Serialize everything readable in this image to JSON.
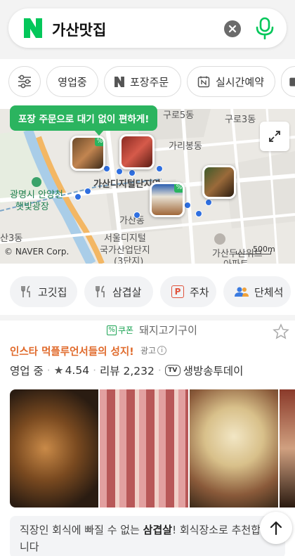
{
  "search": {
    "query": "가산맛집",
    "logo_icon": "naver-n-logo",
    "brand_color": "#03c75a"
  },
  "filters": [
    {
      "label": "",
      "icon": "sliders-icon"
    },
    {
      "label": "영업중"
    },
    {
      "label": "포장주문",
      "icon": "naver-n-icon"
    },
    {
      "label": "실시간예약",
      "icon": "calendar-n-icon"
    }
  ],
  "map": {
    "tooltip": "포장 주문으로 대기 없이 편하게!",
    "labels": {
      "guro3": "구로3동",
      "guro5": "구로5동",
      "garibong": "가리봉동",
      "gasan_digital_station": "가산디지털단지역",
      "gwangmyeong": "광명시 안양천",
      "haetbit": "햇빛광장",
      "gasandong": "가산동",
      "san3": "산3동",
      "seoul_digital_1": "서울디지털",
      "seoul_digital_2": "국가산업단지",
      "seoul_digital_3": "(3단지)",
      "apt_1": "가산두산위브",
      "apt_2": "아파트"
    },
    "credit": "© NAVER Corp.",
    "scale": "500m",
    "thumb_badge": "%"
  },
  "categories": [
    {
      "label": "고깃집",
      "icon": "fork-knife-icon"
    },
    {
      "label": "삼겹살",
      "icon": "fork-knife-icon"
    },
    {
      "label": "주차",
      "icon": "parking-icon",
      "icon_text": "P"
    },
    {
      "label": "단체석",
      "icon": "group-icon"
    }
  ],
  "listing": {
    "coupon_label": "쿠폰",
    "category": "돼지고기구이",
    "promo": "인스타 먹플루언서들의 성지!",
    "ad_label": "광고",
    "status": "영업 중",
    "rating_icon": "★",
    "rating": "4.54",
    "reviews": "리뷰 2,232",
    "tv_icon_text": "TV",
    "tv_label": "생방송투데이",
    "desc_prefix": "직장인 회식에 빠질 수 없는 ",
    "desc_bold": "삼겹살",
    "desc_suffix": "! 회식장소로 추천합니다"
  }
}
